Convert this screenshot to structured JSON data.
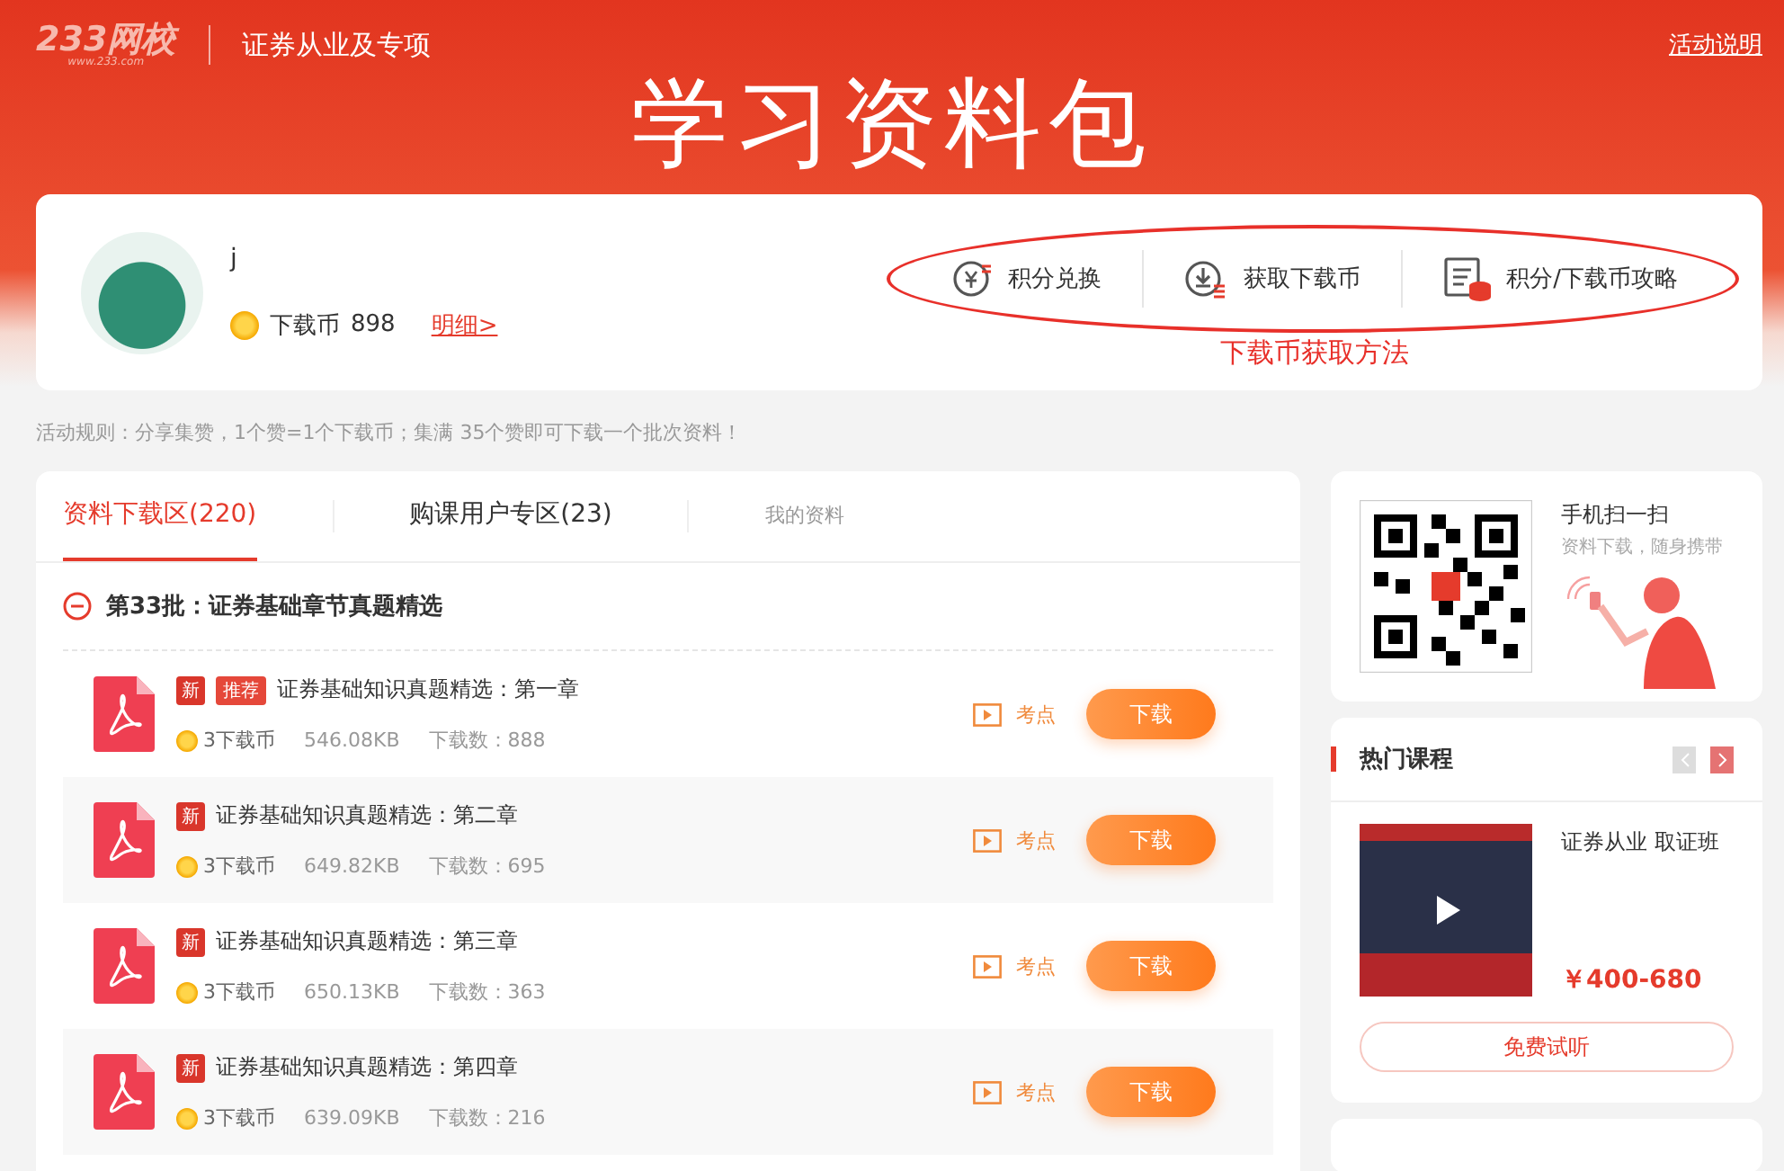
{
  "header": {
    "logo": "233网校",
    "logo_sub": "www.233.com",
    "section": "证券从业及专项",
    "link": "活动说明",
    "banner_title": "学习资料包"
  },
  "profile": {
    "name": "j",
    "coin_label": "下载币",
    "coins": "898",
    "detail_link": "明细>",
    "actions": [
      {
        "label": "积分兑换",
        "kind": "exchange"
      },
      {
        "label": "获取下载币",
        "kind": "download"
      },
      {
        "label": "积分/下载币攻略",
        "kind": "guide"
      }
    ],
    "annotation": "下载币获取方法"
  },
  "rules": "活动规则：分享集赞，1个赞=1个下载币；集满 35个赞即可下载一个批次资料！",
  "tabs": [
    {
      "label": "资料下载区(220)",
      "selected": true,
      "kind": "main"
    },
    {
      "label": "购课用户专区(23)",
      "selected": false,
      "kind": "main"
    },
    {
      "label": "我的资料",
      "selected": false,
      "kind": "minor"
    }
  ],
  "batch": {
    "title": "第33批：证券基础章节真题精选",
    "expanded": true
  },
  "files": [
    {
      "tags": [
        {
          "kind": "new",
          "text": "新"
        },
        {
          "kind": "recommended",
          "text": "推荐"
        }
      ],
      "title": "证券基础知识真题精选：第一章",
      "cost": "3下载币",
      "size": "546.08KB",
      "downloads": "下载数：888",
      "point": "考点",
      "button": "下载"
    },
    {
      "tags": [
        {
          "kind": "new",
          "text": "新"
        }
      ],
      "title": "证券基础知识真题精选：第二章",
      "cost": "3下载币",
      "size": "649.82KB",
      "downloads": "下载数：695",
      "point": "考点",
      "button": "下载"
    },
    {
      "tags": [
        {
          "kind": "new",
          "text": "新"
        }
      ],
      "title": "证券基础知识真题精选：第三章",
      "cost": "3下载币",
      "size": "650.13KB",
      "downloads": "下载数：363",
      "point": "考点",
      "button": "下载"
    },
    {
      "tags": [
        {
          "kind": "new",
          "text": "新"
        }
      ],
      "title": "证券基础知识真题精选：第四章",
      "cost": "3下载币",
      "size": "639.09KB",
      "downloads": "下载数：216",
      "point": "考点",
      "button": "下载"
    }
  ],
  "qr_card": {
    "title": "手机扫一扫",
    "subtitle": "资料下载，随身携带"
  },
  "hot_courses": {
    "title": "热门课程",
    "prev_disabled": true,
    "course": {
      "name": "证券从业 取证班",
      "price": "￥400-680",
      "button": "免费试听"
    }
  }
}
